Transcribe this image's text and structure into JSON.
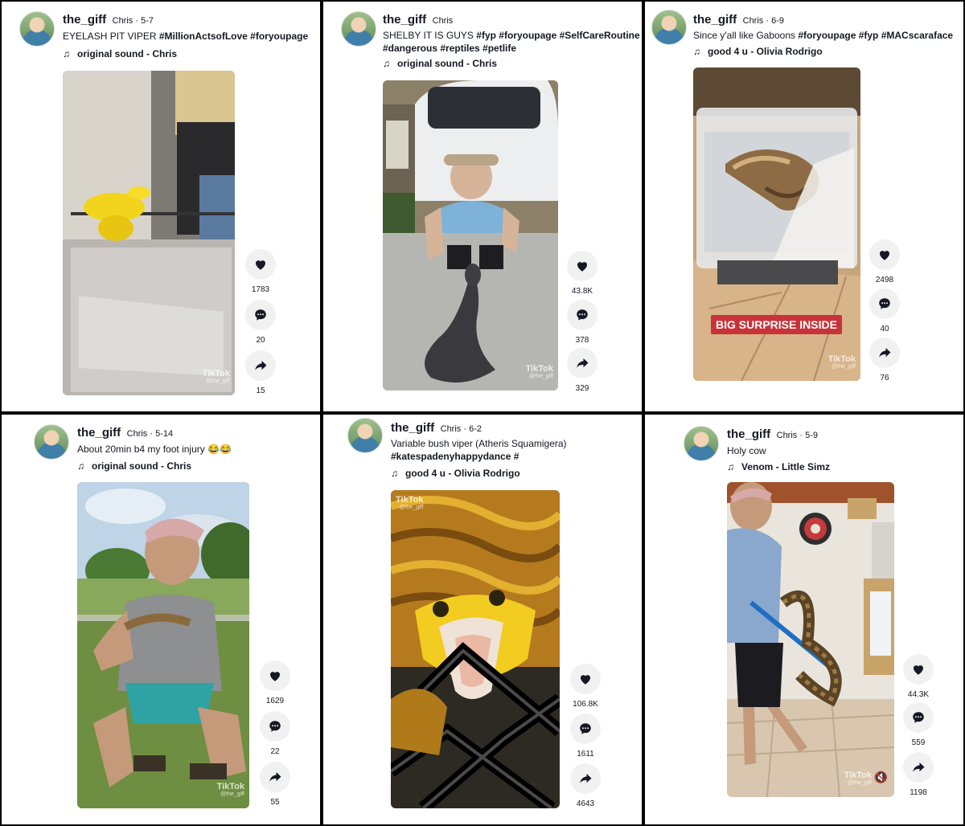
{
  "posts": [
    {
      "username": "the_giff",
      "nickname": "Chris",
      "date": "5-7",
      "desc_plain": "EYELASH PIT VIPER ",
      "tags1": "#MillionActsofLove #foryoupage",
      "tags2": "",
      "sound": "original sound - Chris",
      "likes": "1783",
      "comments": "20",
      "shares": "15",
      "watermark": "TikTok",
      "handle": "@the_giff",
      "overlay": ""
    },
    {
      "username": "the_giff",
      "nickname": "Chris",
      "date": "",
      "desc_plain": "SHELBY IT IS GUYS ",
      "tags1": "#fyp #foryoupage #SelfCareRoutine",
      "tags2": "#dangerous #reptiles #petlife",
      "sound": "original sound - Chris",
      "likes": "43.8K",
      "comments": "378",
      "shares": "329",
      "watermark": "TikTok",
      "handle": "@the_giff",
      "overlay": ""
    },
    {
      "username": "the_giff",
      "nickname": "Chris",
      "date": "6-9",
      "desc_plain": "Since y'all like Gaboons ",
      "tags1": "#foryoupage #fyp #MACscaraface",
      "tags2": "",
      "sound": "good 4 u - Olivia Rodrigo",
      "likes": "2498",
      "comments": "40",
      "shares": "76",
      "watermark": "TikTok",
      "handle": "@the_giff",
      "overlay": "BIG SURPRISE INSIDE"
    },
    {
      "username": "the_giff",
      "nickname": "Chris",
      "date": "5-14",
      "desc_plain": "About 20min b4 my foot injury 😂😂",
      "tags1": "",
      "tags2": "",
      "sound": "original sound - Chris",
      "likes": "1629",
      "comments": "22",
      "shares": "55",
      "watermark": "TikTok",
      "handle": "@the_giff",
      "overlay": ""
    },
    {
      "username": "the_giff",
      "nickname": "Chris",
      "date": "6-2",
      "desc_plain": "Variable bush viper (Atheris Squamigera)",
      "tags1": "",
      "tags2": "#katespadenyhappydance #",
      "sound": "good 4 u - Olivia Rodrigo",
      "likes": "106.8K",
      "comments": "1611",
      "shares": "4643",
      "watermark": "TikTok",
      "handle": "@the_giff",
      "overlay": ""
    },
    {
      "username": "the_giff",
      "nickname": "Chris",
      "date": "5-9",
      "desc_plain": "Holy cow",
      "tags1": "",
      "tags2": "",
      "sound": "Venom - Little Simz",
      "likes": "44.3K",
      "comments": "559",
      "shares": "1198",
      "watermark": "TikTok",
      "handle": "@the_giff",
      "overlay": ""
    }
  ],
  "date_separator": " · ",
  "icons": {
    "music": "music-note-icon",
    "like": "heart-icon",
    "comment": "comment-icon",
    "share": "share-arrow-icon",
    "mute": "mute-icon"
  }
}
